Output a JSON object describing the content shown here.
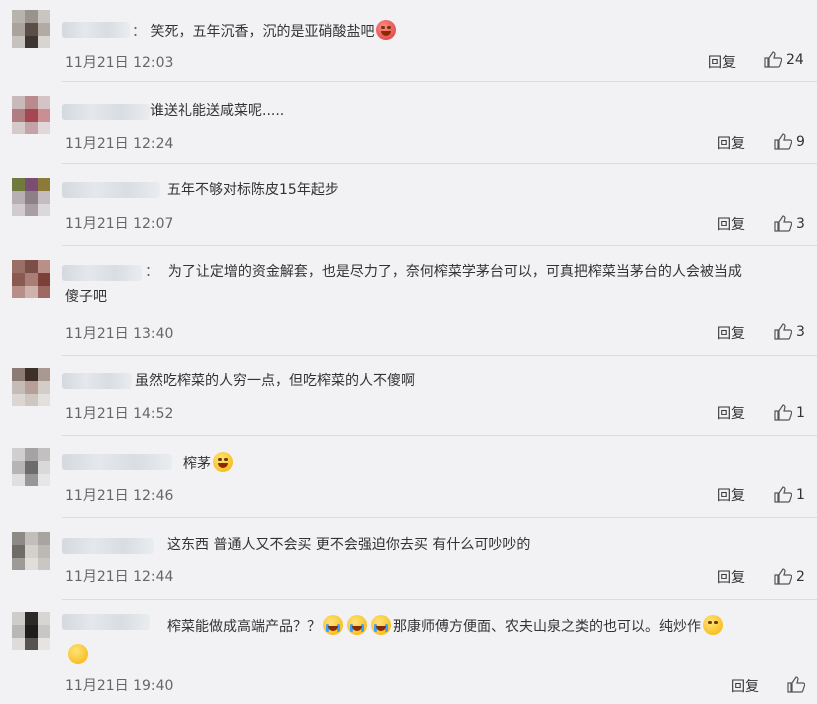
{
  "comments": [
    {
      "text_before": "：",
      "text": "笑死，五年沉香，沉的是亚硝酸盐吧",
      "emoji": "angry-face-emoji",
      "time": "11月21日 12:03",
      "reply": "回复",
      "likes": "24"
    },
    {
      "text_before": "",
      "text": "谁送礼能送咸菜呢.....",
      "emoji": "",
      "time": "11月21日 12:24",
      "reply": "回复",
      "likes": "9"
    },
    {
      "text_before": "",
      "text": "五年不够对标陈皮15年起步",
      "emoji": "",
      "time": "11月21日 12:07",
      "reply": "回复",
      "likes": "3"
    },
    {
      "text_before": "：",
      "text": "为了让定增的资金解套，也是尽力了，奈何榨菜学茅台可以，可真把榨菜当茅台的人会被当成",
      "text2": "傻子吧",
      "emoji": "",
      "time": "11月21日 13:40",
      "reply": "回复",
      "likes": "3"
    },
    {
      "text_before": "",
      "text": "虽然吃榨菜的人穷一点，但吃榨菜的人不傻啊",
      "emoji": "",
      "time": "11月21日 14:52",
      "reply": "回复",
      "likes": "1"
    },
    {
      "text_before": "",
      "text": "榨茅",
      "emoji": "laughing-face-emoji",
      "time": "11月21日 12:46",
      "reply": "回复",
      "likes": "1"
    },
    {
      "text_before": "",
      "text": "这东西 普通人又不会买 更不会强迫你去买 有什么可吵吵的",
      "emoji": "",
      "time": "11月21日 12:44",
      "reply": "回复",
      "likes": "2"
    },
    {
      "text_before": "",
      "text": "榨菜能做成高端产品？？",
      "text_after": "那康师傅方便面、农夫山泉之类的也可以。纯炒作",
      "emoji": "crying-laughing-emoji",
      "time": "11月21日 19:40",
      "reply": "回复",
      "likes": ""
    }
  ]
}
